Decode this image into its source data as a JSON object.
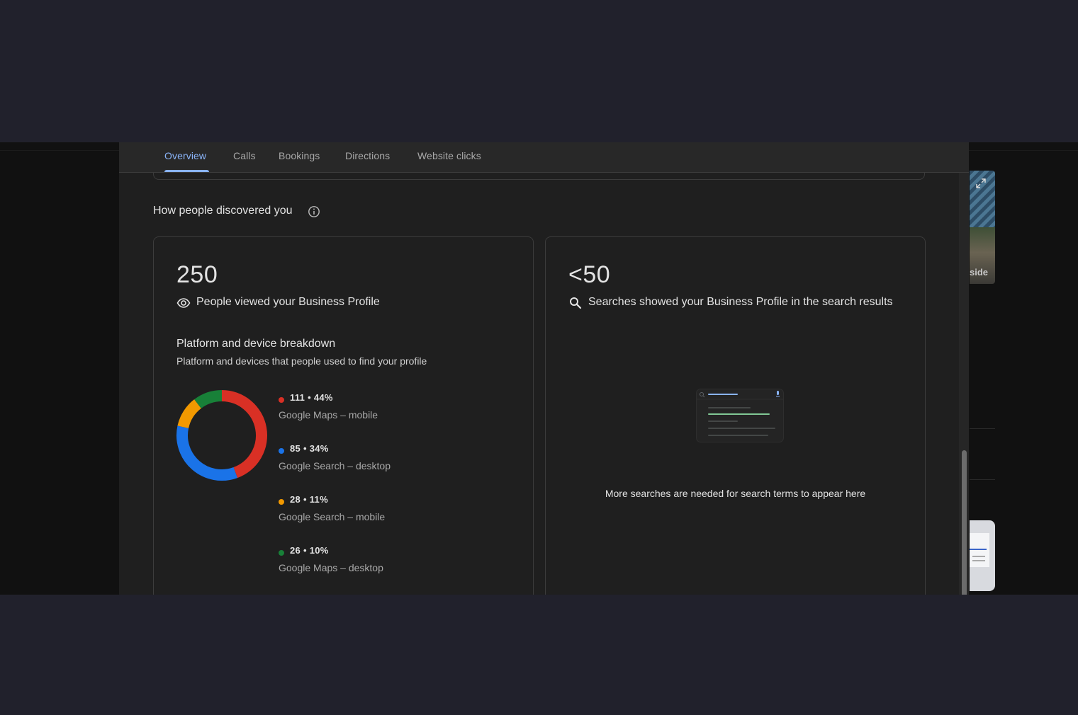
{
  "tabs": [
    {
      "label": "Overview",
      "active": true
    },
    {
      "label": "Calls"
    },
    {
      "label": "Bookings"
    },
    {
      "label": "Directions"
    },
    {
      "label": "Website clicks"
    }
  ],
  "section": {
    "title": "How people discovered you",
    "info_icon": "info-icon"
  },
  "views_card": {
    "value": "250",
    "icon": "eye-icon",
    "label": "People viewed your Business Profile",
    "breakdown_title": "Platform and device breakdown",
    "breakdown_subtitle": "Platform and devices that people used to find your profile"
  },
  "chart_data": {
    "type": "pie",
    "categories": [
      "Google Maps – mobile",
      "Google Search – desktop",
      "Google Search – mobile",
      "Google Maps – desktop"
    ],
    "values": [
      111,
      85,
      28,
      26
    ],
    "percents": [
      44,
      34,
      11,
      10
    ],
    "labels": [
      "111 • 44%",
      "85 • 34%",
      "28 • 11%",
      "26 • 10%"
    ],
    "colors": [
      "#d93025",
      "#1a73e8",
      "#f29900",
      "#188038"
    ]
  },
  "searches_card": {
    "value": "<50",
    "icon": "search-icon",
    "label": "Searches showed your Business Profile in the search results",
    "empty_message": "More searches are needed for search terms to appear here"
  },
  "background": {
    "partial_label": "side"
  }
}
